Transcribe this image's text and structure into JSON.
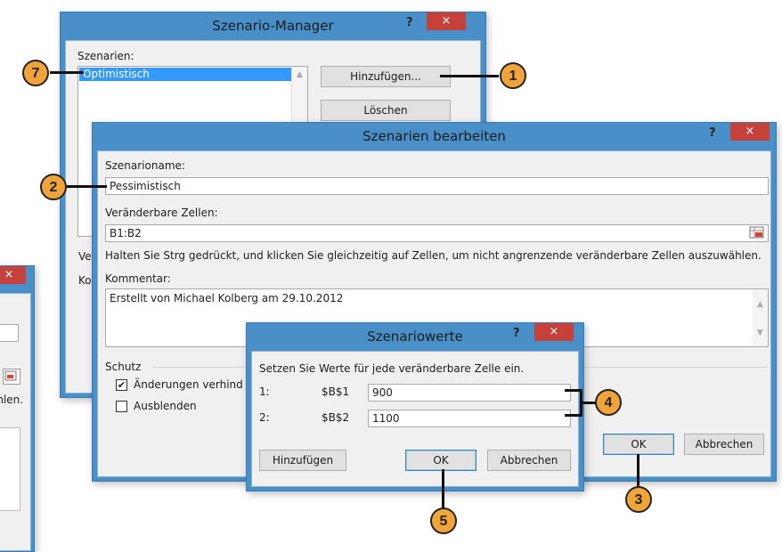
{
  "scenario_manager": {
    "title": "Szenario-Manager",
    "help": "?",
    "close": "×",
    "scenarios_label": "Szenarien:",
    "scenarios": [
      "Optimistisch"
    ],
    "add_button": "Hinzufügen...",
    "delete_button": "Löschen",
    "partial_label_1": "Ve",
    "partial_label_2": "Ko"
  },
  "back_window": {
    "close": "×",
    "partial_text": "ählen."
  },
  "edit_scenario": {
    "title": "Szenarien bearbeiten",
    "help": "?",
    "close": "×",
    "name_label": "Szenarioname:",
    "name_value": "Pessimistisch",
    "cells_label": "Veränderbare Zellen:",
    "cells_value": "B1:B2",
    "hint": "Halten Sie Strg gedrückt, und klicken Sie gleichzeitig auf Zellen, um nicht angrenzende veränderbare Zellen auszuwählen.",
    "comment_label": "Kommentar:",
    "comment_value": "Erstellt von Michael Kolberg am 29.10.2012",
    "protection_label": "Schutz",
    "prevent_changes_label": "Änderungen verhind",
    "prevent_changes_checked": true,
    "hide_label": "Ausblenden",
    "hide_checked": false,
    "ok_button": "OK",
    "cancel_button": "Abbrechen"
  },
  "scenario_values": {
    "title": "Szenariowerte",
    "help": "?",
    "close": "×",
    "instruction": "Setzen Sie Werte für jede veränderbare Zelle ein.",
    "rows": [
      {
        "index": "1:",
        "cell": "$B$1",
        "value": "900"
      },
      {
        "index": "2:",
        "cell": "$B$2",
        "value": "1100"
      }
    ],
    "add_button": "Hinzufügen",
    "ok_button": "OK",
    "cancel_button": "Abbrechen"
  },
  "callouts": [
    "7",
    "1",
    "2",
    "4",
    "3",
    "5"
  ],
  "colors": {
    "titlebar": "#4a90c8",
    "close": "#c7413b",
    "callout": "#f0a43a",
    "selection": "#3399ff"
  }
}
